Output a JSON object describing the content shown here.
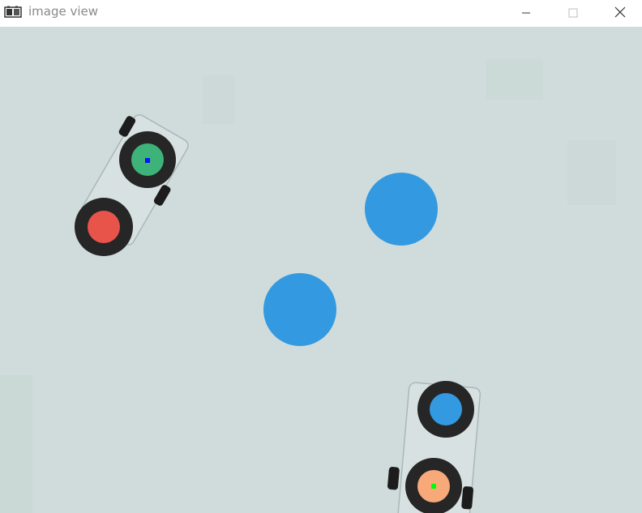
{
  "window": {
    "title": "image view",
    "app_icon": "camera-film-icon",
    "controls": {
      "minimize_icon": "minimize-icon",
      "maximize_icon": "maximize-icon",
      "close_icon": "close-icon"
    }
  },
  "scene": {
    "background_color": "#cfdcdb",
    "targets": [
      {
        "name": "blue-circle-upper",
        "color": "#3399e0"
      },
      {
        "name": "blue-circle-lower",
        "color": "#3399e0"
      }
    ],
    "robots": [
      {
        "name": "robot-top-left",
        "front_marker_color": "#3db37a",
        "rear_marker_color": "#e8544a",
        "center_dot_color": "#0010ff"
      },
      {
        "name": "robot-bottom-right",
        "front_marker_color": "#3399e0",
        "rear_marker_color": "#f7a97a",
        "center_dot_color": "#00ff00"
      }
    ]
  }
}
